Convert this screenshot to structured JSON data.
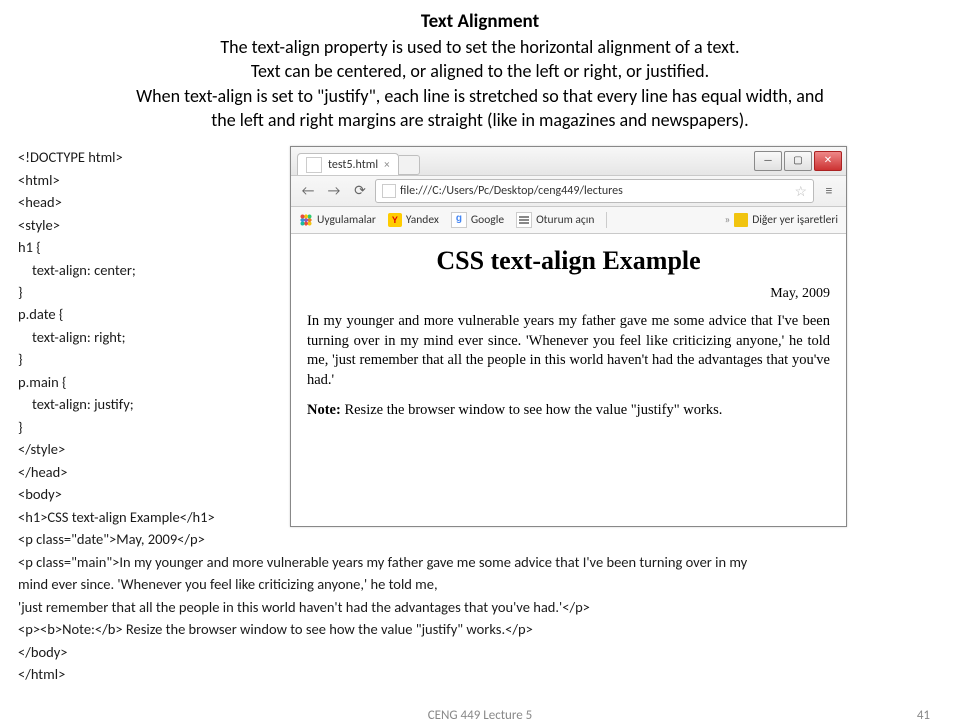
{
  "title": {
    "heading": "Text Alignment",
    "p1": "The text-align property is used to set the horizontal alignment of a text.",
    "p2": "Text can be centered, or aligned to the left or right, or justified.",
    "p3": "When text-align is set to \"justify\", each line is stretched so that every line has equal width, and",
    "p4": "the left and right margins are straight (like in magazines and newspapers)."
  },
  "code": {
    "l1": "<!DOCTYPE html>",
    "l2": "<html>",
    "l3": "<head>",
    "l4": "<style>",
    "l5": "h1 {",
    "l6": "text-align: center;",
    "l7": "}",
    "l8": "p.date {",
    "l9": "text-align: right;",
    "l10": "}",
    "l11": "p.main {",
    "l12": "text-align: justify;",
    "l13": "}",
    "l14": "</style>",
    "l15": "</head>",
    "l16": "<body>",
    "l17": "<h1>CSS text-align Example</h1>",
    "l18": "<p class=\"date\">May, 2009</p>",
    "l19": "<p class=\"main\">In my younger and more vulnerable years my father gave me some advice that I've been turning over in my",
    "l20": "mind ever since. 'Whenever you feel like criticizing anyone,' he told me,",
    "l21": "'just remember that all the people in this world haven't had the advantages that you've had.'</p>",
    "l22": "<p><b>Note:</b> Resize the browser window to see how the value \"justify\" works.</p>",
    "l23": "</body>",
    "l24": "</html>"
  },
  "browser": {
    "tab_title": "test5.html",
    "url": "file:///C:/Users/Pc/Desktop/ceng449/lectures",
    "bm_apps": "Uygulamalar",
    "bm_yandex": "Yandex",
    "bm_google": "Google",
    "bm_login": "Oturum açın",
    "bm_other": "Diğer yer işaretleri",
    "page": {
      "h1": "CSS text-align Example",
      "date": "May, 2009",
      "main": "In my younger and more vulnerable years my father gave me some advice that I've been turning over in my mind ever since. 'Whenever you feel like criticizing anyone,' he told me, 'just remember that all the people in this world haven't had the advantages that you've had.'",
      "note_label": "Note:",
      "note_text": " Resize the browser window to see how the value \"justify\" works."
    }
  },
  "footer": {
    "lecture": "CENG 449 Lecture 5",
    "page": "41"
  }
}
